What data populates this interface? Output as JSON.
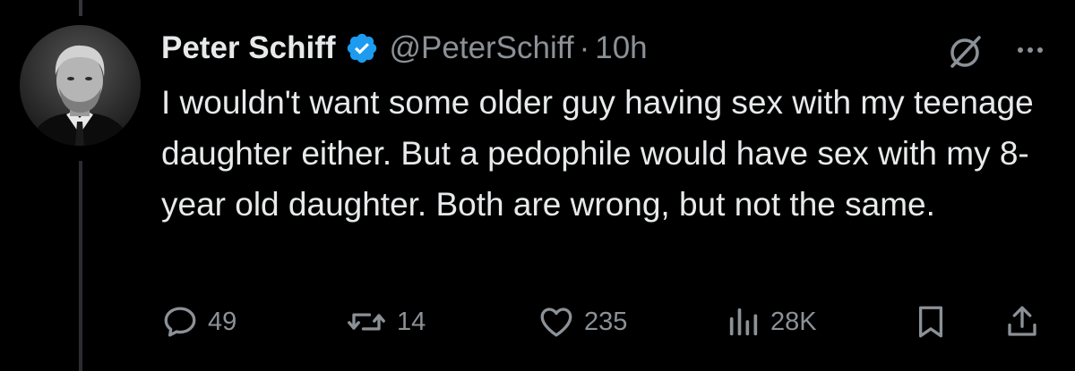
{
  "tweet": {
    "author": {
      "display_name": "Peter Schiff",
      "handle": "@PeterSchiff",
      "verified": true
    },
    "separator": "·",
    "time_ago": "10h",
    "text": "I wouldn't want some older guy having sex with my teenage daughter either. But a pedophile would have sex with my 8-year old daughter. Both are wrong, but not the same."
  },
  "actions": {
    "replies": "49",
    "reposts": "14",
    "likes": "235",
    "views": "28K"
  },
  "icons": {
    "verified": "verified-badge-icon",
    "grok": "grok-icon",
    "more": "more-icon",
    "reply": "reply-icon",
    "repost": "repost-icon",
    "like": "like-icon",
    "views": "views-icon",
    "bookmark": "bookmark-icon",
    "share": "share-icon"
  },
  "colors": {
    "background": "#000000",
    "text_primary": "#e7e9ea",
    "text_secondary": "#8b9196",
    "verified_blue": "#1d9bf0"
  }
}
